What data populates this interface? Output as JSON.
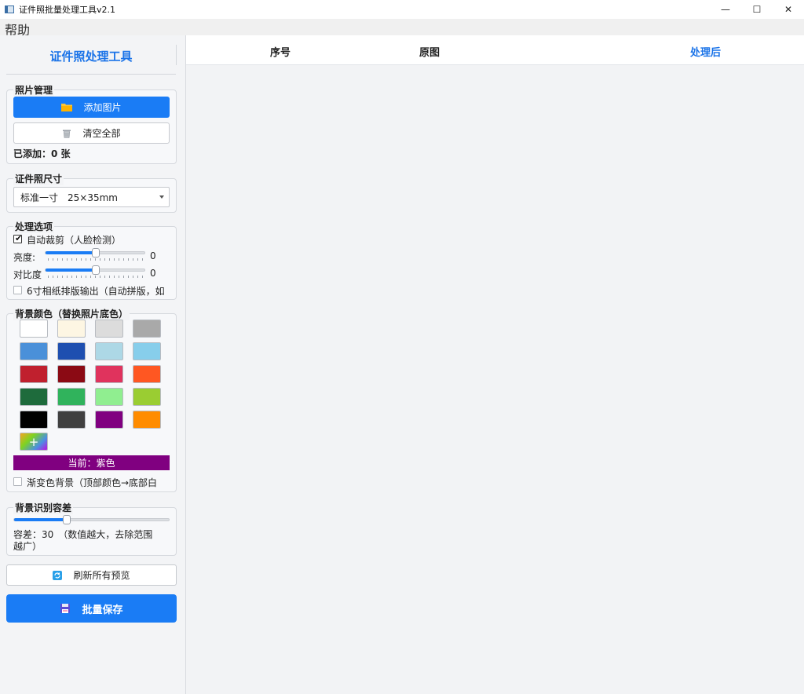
{
  "window": {
    "title": "证件照批量处理工具v2.1",
    "controls": {
      "minimize": "—",
      "maximize": "☐",
      "close": "✕"
    }
  },
  "menu": {
    "help": "帮助"
  },
  "sidebar": {
    "title": "证件照处理工具",
    "photo_mgmt": {
      "label": "照片管理",
      "add_button": "添加图片",
      "clear_button": "清空全部",
      "count_text": "已添加：0 张"
    },
    "size": {
      "label": "证件照尺寸",
      "selected": "标准一寸　25×35mm"
    },
    "options": {
      "label": "处理选项",
      "auto_crop": {
        "label": "自动裁剪（人脸检测）",
        "checked": true
      },
      "brightness": {
        "label": "亮度:",
        "value": "0",
        "level": 0.5
      },
      "contrast": {
        "label": "对比度",
        "value": "0",
        "level": 0.5
      },
      "layout_6inch": {
        "label": "6寸相纸排版输出（自动拼版，如",
        "checked": false
      }
    },
    "background": {
      "label": "背景颜色（替换照片底色）",
      "swatches": [
        "#ffffff",
        "#fdf6e3",
        "#dcdcdc",
        "#a9a9a9",
        "#4a90d9",
        "#1e4fb0",
        "#add8e6",
        "#87ceeb",
        "#c0202e",
        "#8b0a14",
        "#e0335d",
        "#ff5722",
        "#1e6b3c",
        "#30b35c",
        "#90ee90",
        "#9acd32",
        "#000000",
        "#404040",
        "#800080",
        "#ff8c00"
      ],
      "add_symbol": "+",
      "current": "当前：紫色",
      "current_color": "#800080",
      "gradient": {
        "label": "渐变色背景（顶部颜色→底部白",
        "checked": false
      }
    },
    "tolerance": {
      "label": "背景识别容差",
      "level": 0.34,
      "text_line1": "容差：30　（数值越大，去除范围",
      "text_line2": "越广）"
    },
    "refresh_button": "刷新所有预览",
    "save_button": "批量保存"
  },
  "table": {
    "columns": [
      "序号",
      "原图",
      "处理后"
    ]
  },
  "colors": {
    "accent": "#1a7cf5",
    "purple": "#800080"
  }
}
